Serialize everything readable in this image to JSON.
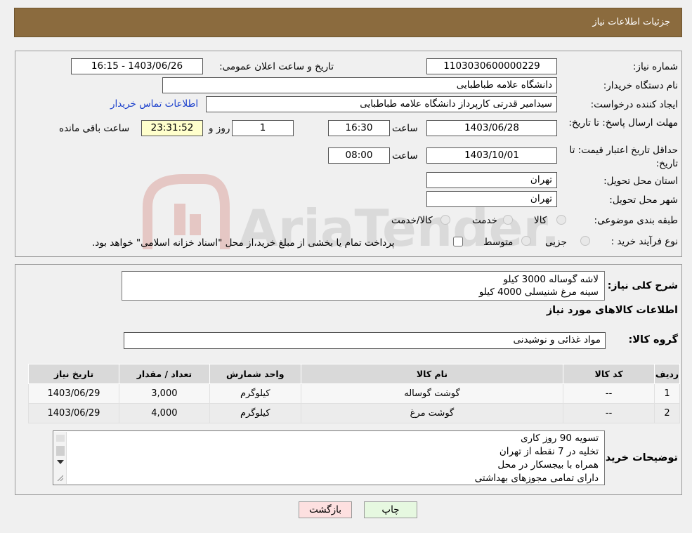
{
  "header": {
    "title": "جزئیات اطلاعات نیاز"
  },
  "form": {
    "need_number_label": "شماره نیاز:",
    "need_number": "1103030600000229",
    "announce_label": "تاریخ و ساعت اعلان عمومی:",
    "announce_value": "1403/06/26 - 16:15",
    "buyer_org_label": "نام دستگاه خریدار:",
    "buyer_org": "دانشگاه علامه طباطبایی",
    "creator_label": "ایجاد کننده درخواست:",
    "creator": "سیدامیر قدرتی کارپرداز دانشگاه علامه طباطبایی",
    "contact_link": "اطلاعات تماس خریدار",
    "deadline_label": "مهلت ارسال پاسخ: تا تاریخ:",
    "deadline_date": "1403/06/28",
    "time_label": "ساعت",
    "deadline_time": "16:30",
    "days_value": "1",
    "days_label": "روز و",
    "remaining_time": "23:31:52",
    "remaining_label": "ساعت باقی مانده",
    "validity_label": "حداقل تاریخ اعتبار قیمت: تا تاریخ:",
    "validity_date": "1403/10/01",
    "validity_time": "08:00",
    "province_label": "استان محل تحویل:",
    "province": "تهران",
    "city_label": "شهر محل تحویل:",
    "city": "تهران",
    "category_label": "طبقه بندی موضوعی:",
    "category_options": [
      "کالا",
      "خدمت",
      "کالا/خدمت"
    ],
    "process_label": "نوع فرآیند خرید :",
    "process_options": [
      "جزیی",
      "متوسط"
    ],
    "payment_note": "پرداخت تمام یا بخشی از مبلغ خرید،از محل \"اسناد خزانه اسلامی\" خواهد بود."
  },
  "description": {
    "label": "شرح کلی نیاز:",
    "lines": [
      "لاشه گوساله 3000 کیلو",
      "سینه مرغ شنیسلی 4000 کیلو"
    ]
  },
  "goods": {
    "section_title": "اطلاعات کالاهای مورد نیاز",
    "group_label": "گروه کالا:",
    "group_value": "مواد غذائی و نوشیدنی",
    "columns": [
      "ردیف",
      "کد کالا",
      "نام کالا",
      "واحد شمارش",
      "تعداد / مقدار",
      "تاریخ نیاز"
    ],
    "rows": [
      [
        "1",
        "--",
        "گوشت گوساله",
        "کیلوگرم",
        "3,000",
        "1403/06/29"
      ],
      [
        "2",
        "--",
        "گوشت مرغ",
        "کیلوگرم",
        "4,000",
        "1403/06/29"
      ]
    ]
  },
  "buyer_notes": {
    "label": "توضیحات خریدار:",
    "lines": [
      "تسویه 90 روز کاری",
      "تخلیه در 7 نقطه از تهران",
      "همراه با بیجسکار در محل",
      "دارای تمامی مجوزهای بهداشتی"
    ]
  },
  "buttons": {
    "back": "بازگشت",
    "print": "چاپ"
  },
  "watermark": {
    "text": "AriaTender.neT"
  },
  "colors": {
    "header": "#8b6b3e",
    "link": "#1a3fcc",
    "time_box": "#ffffcc",
    "back_btn": "#fde0e0",
    "print_btn": "#e6f8e0"
  }
}
